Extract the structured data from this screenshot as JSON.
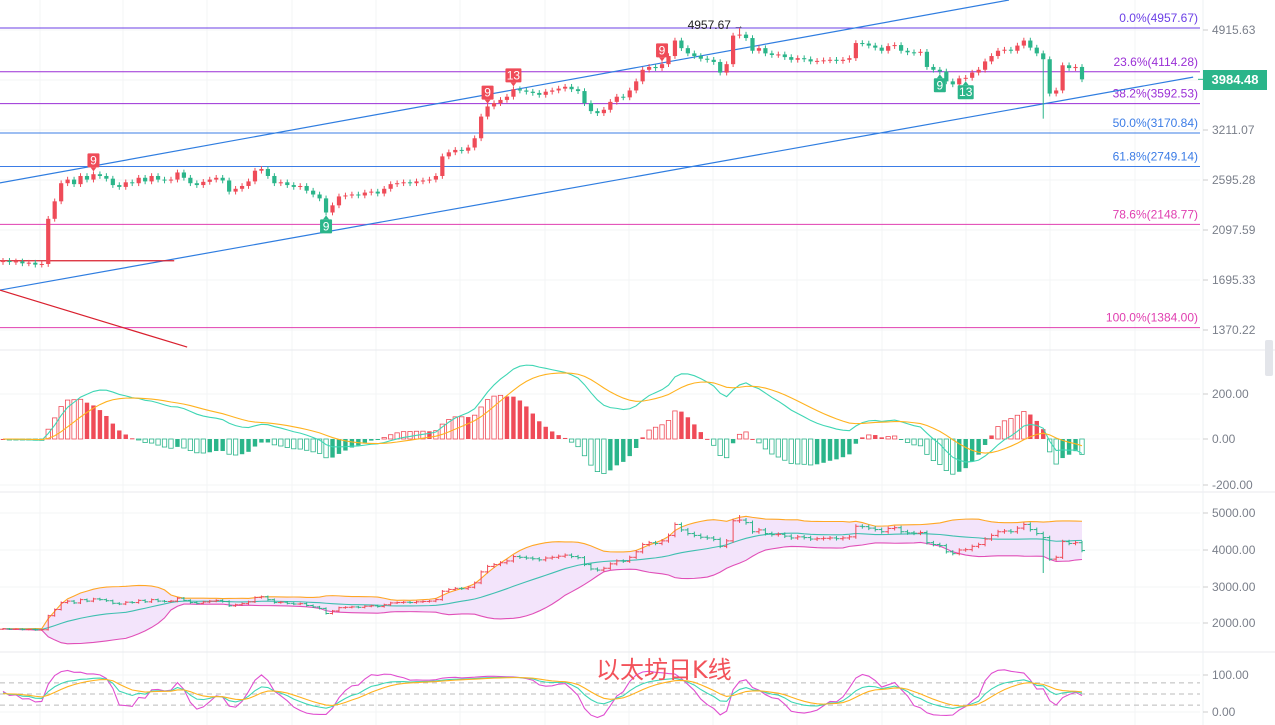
{
  "title": "以太坊日K线",
  "chart_data": [
    {
      "type": "candlestick",
      "scale": "log",
      "y_ticks": [
        "4915.63",
        "3211.07",
        "2595.28",
        "2097.59",
        "1695.33",
        "1370.22"
      ],
      "current_price": "3984.48",
      "high_label": "4957.67",
      "high_index": 114,
      "low_override": {
        "index": 161,
        "value": 3370
      },
      "up_color": "#ef4b58",
      "down_color": "#2bb58a",
      "closes": [
        1840,
        1830,
        1835,
        1820,
        1825,
        1810,
        1815,
        2200,
        2370,
        2560,
        2600,
        2550,
        2640,
        2600,
        2660,
        2640,
        2610,
        2540,
        2520,
        2570,
        2560,
        2620,
        2580,
        2640,
        2600,
        2590,
        2600,
        2680,
        2620,
        2560,
        2540,
        2575,
        2600,
        2620,
        2590,
        2470,
        2500,
        2530,
        2580,
        2700,
        2720,
        2640,
        2560,
        2570,
        2540,
        2520,
        2530,
        2480,
        2440,
        2400,
        2260,
        2330,
        2420,
        2430,
        2440,
        2430,
        2460,
        2470,
        2450,
        2500,
        2550,
        2560,
        2570,
        2560,
        2580,
        2590,
        2600,
        2640,
        2870,
        2920,
        2950,
        2940,
        2980,
        3100,
        3400,
        3550,
        3600,
        3650,
        3700,
        3820,
        3800,
        3780,
        3760,
        3730,
        3780,
        3800,
        3830,
        3860,
        3820,
        3790,
        3600,
        3480,
        3450,
        3500,
        3620,
        3700,
        3690,
        3800,
        3950,
        4150,
        4200,
        4180,
        4250,
        4400,
        4700,
        4550,
        4450,
        4400,
        4350,
        4330,
        4290,
        4100,
        4250,
        4800,
        4820,
        4750,
        4500,
        4550,
        4450,
        4420,
        4430,
        4380,
        4330,
        4360,
        4340,
        4300,
        4310,
        4320,
        4330,
        4310,
        4330,
        4360,
        4650,
        4640,
        4600,
        4560,
        4500,
        4590,
        4610,
        4500,
        4470,
        4460,
        4480,
        4200,
        4150,
        4120,
        3950,
        3900,
        4000,
        4010,
        4100,
        4150,
        4300,
        4400,
        4500,
        4520,
        4500,
        4600,
        4700,
        4560,
        4450,
        4340,
        3750,
        3800,
        4230,
        4180,
        4200,
        3984.48
      ],
      "fibonacci": [
        {
          "label": "0.0%(4957.67)",
          "value": 4957.67,
          "color": "#6b3fe6"
        },
        {
          "label": "23.6%(4114.28)",
          "value": 4114.28,
          "color": "#9a2fd6"
        },
        {
          "label": "38.2%(3592.53)",
          "value": 3592.53,
          "color": "#9a2fd6"
        },
        {
          "label": "50.0%(3170.84)",
          "value": 3170.84,
          "color": "#3b7ce6"
        },
        {
          "label": "61.8%(2749.14)",
          "value": 2749.14,
          "color": "#3b7ce6"
        },
        {
          "label": "78.6%(2148.77)",
          "value": 2148.77,
          "color": "#e03fb0"
        },
        {
          "label": "100.0%(1384.00)",
          "value": 1384.0,
          "color": "#e03fb0"
        }
      ],
      "trend_lines": [
        {
          "name": "channel-upper",
          "color": "#2f7de0",
          "points": [
            [
              -0.5,
              2563
            ],
            [
              155.7,
              5585
            ]
          ]
        },
        {
          "name": "channel-lower",
          "color": "#2f7de0",
          "points": [
            [
              -0.5,
              1624
            ],
            [
              184.2,
              4022
            ]
          ]
        },
        {
          "name": "support-horizontal",
          "color": "#d9202e",
          "points": [
            [
              -0.5,
              1840
            ],
            [
              26.5,
              1840
            ]
          ]
        },
        {
          "name": "descending",
          "color": "#d9202e",
          "points": [
            [
              -0.5,
              1624
            ],
            [
              28.5,
              1274
            ]
          ]
        }
      ],
      "markers": [
        {
          "index": 14,
          "text": "9",
          "position": "above",
          "color": "#ef4b58"
        },
        {
          "index": 75,
          "text": "9",
          "position": "above",
          "color": "#ef4b58"
        },
        {
          "index": 79,
          "text": "13",
          "position": "above",
          "color": "#ef4b58"
        },
        {
          "index": 102,
          "text": "9",
          "position": "above",
          "color": "#ef4b58"
        },
        {
          "index": 50,
          "text": "9",
          "position": "below",
          "color": "#2bb58a"
        },
        {
          "index": 145,
          "text": "9",
          "position": "below",
          "color": "#2bb58a"
        },
        {
          "index": 149,
          "text": "13",
          "position": "below",
          "color": "#2bb58a"
        }
      ]
    },
    {
      "type": "macd",
      "params": [
        12,
        26,
        9
      ],
      "y_ticks": [
        "200.00",
        "0.00",
        "-200.00"
      ],
      "dif_color": "#3fd6b4",
      "dea_color": "#ffb21f"
    },
    {
      "type": "boll",
      "params": [
        20,
        2
      ],
      "y_ticks": [
        "5000.00",
        "4000.00",
        "3000.00",
        "2000.00"
      ],
      "upper_color": "#ffa726",
      "mid_color": "#3fbfb0",
      "lower_color": "#e04fb8",
      "band_fill": "#f3e4fb"
    },
    {
      "type": "kdj",
      "params": [
        9,
        3,
        3
      ],
      "y_ticks": [
        "100.00",
        "0.00"
      ],
      "k_color": "#3fd6b4",
      "d_color": "#ffb21f",
      "j_color": "#e04fd0"
    }
  ]
}
